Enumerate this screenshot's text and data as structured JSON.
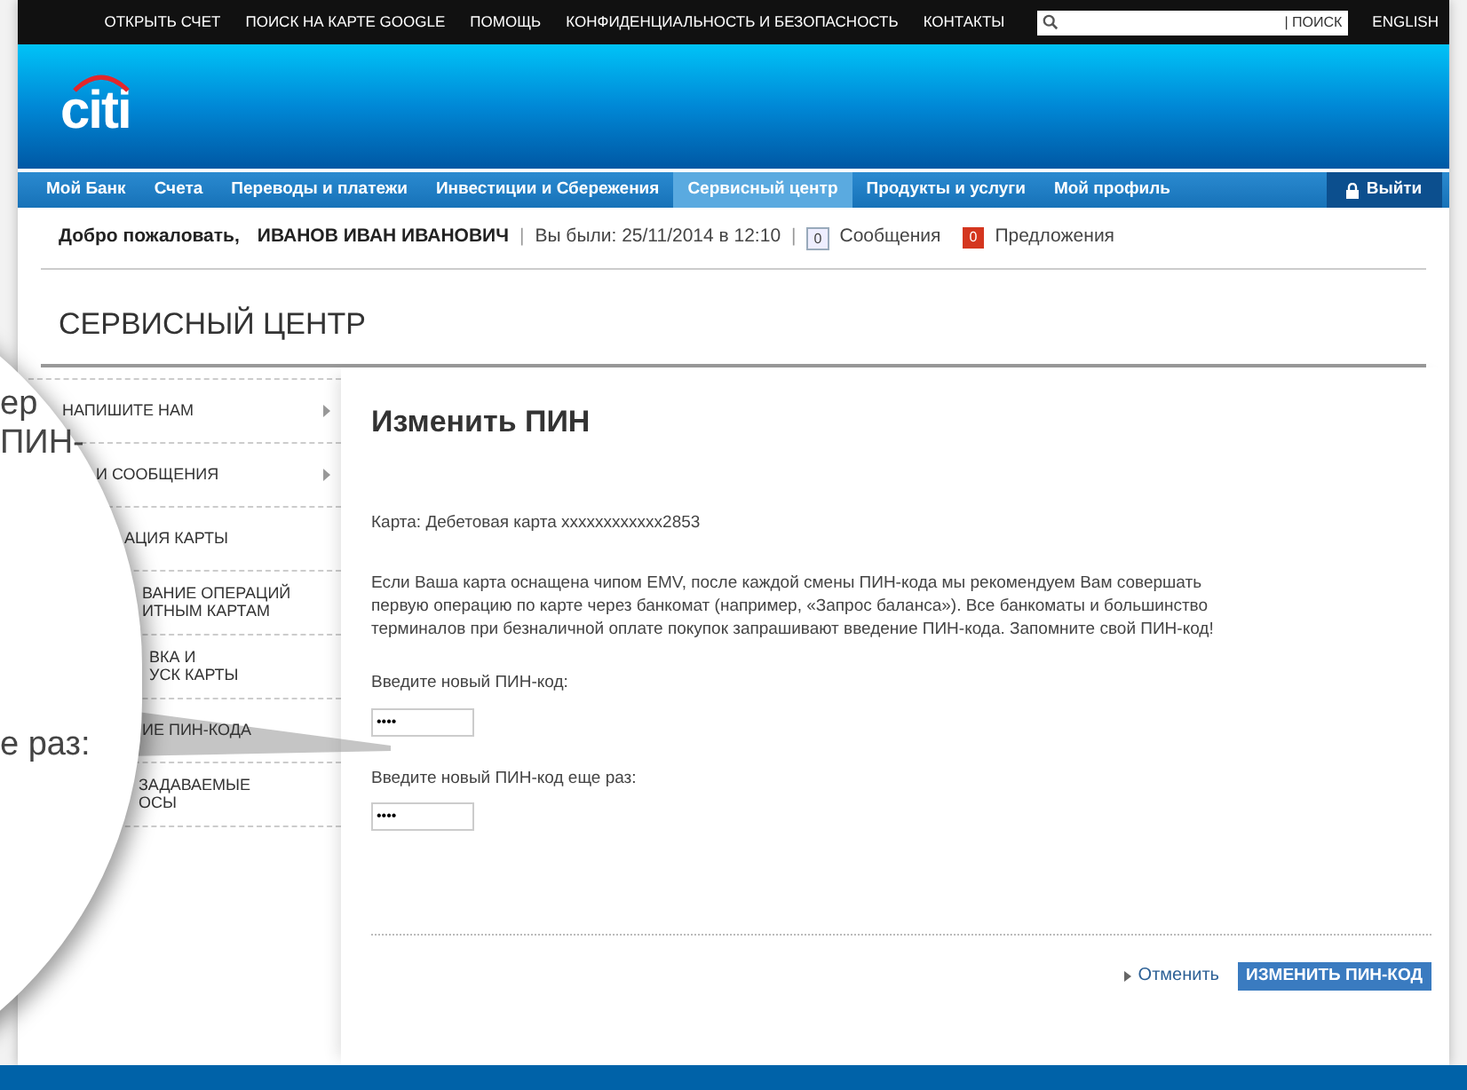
{
  "top_bar": {
    "links": [
      "ОТКРЫТЬ СЧЕТ",
      "ПОИСК НА КАРТЕ GOOGLE",
      "ПОМОЩЬ",
      "КОНФИДЕНЦИАЛЬНОСТЬ И БЕЗОПАСНОСТЬ",
      "КОНТАКТЫ"
    ],
    "search_button": "| ПОИСК",
    "language": "ENGLISH"
  },
  "header": {
    "logo": "citi"
  },
  "nav": {
    "items": [
      {
        "label": "Мой Банк",
        "selected": false
      },
      {
        "label": "Счета",
        "selected": false
      },
      {
        "label": "Переводы и платежи",
        "selected": false
      },
      {
        "label": "Инвестиции и Сбережения",
        "selected": false
      },
      {
        "label": "Сервисный центр",
        "selected": true
      },
      {
        "label": "Продукты и услуги",
        "selected": false
      },
      {
        "label": "Мой профиль",
        "selected": false
      }
    ],
    "logout": "Выйти"
  },
  "welcome": {
    "greeting": "Добро пожаловать,",
    "name": "ИВАНОВ ИВАН ИВАНОВИЧ",
    "separators": [
      "|",
      "|"
    ],
    "last_visit": "Вы были: 25/11/2014 в 12:10",
    "messages_count": "0",
    "messages": "Сообщения",
    "offers_count": "0",
    "offers": "Предложения"
  },
  "page_title": "СЕРВИСНЫЙ ЦЕНТР",
  "sidebar": {
    "items": [
      {
        "lines": [
          "НАПИШИТЕ НАМ"
        ],
        "has_arrow": true
      },
      {
        "lines": [
          "И СООБЩЕНИЯ"
        ],
        "has_arrow": true
      },
      {
        "lines": [
          "АЦИЯ КАРТЫ"
        ],
        "has_arrow": false
      },
      {
        "lines": [
          "ВАНИЕ ОПЕРАЦИЙ",
          "ИТНЫМ КАРТАМ"
        ],
        "has_arrow": false
      },
      {
        "lines": [
          "ВКА И",
          "УСК КАРТЫ"
        ],
        "has_arrow": false
      },
      {
        "lines": [
          "ИЕ ПИН-КОДА"
        ],
        "has_arrow": false
      },
      {
        "lines": [
          "ЗАДАВАЕМЫЕ",
          "ОСЫ"
        ],
        "has_arrow": false
      }
    ]
  },
  "magnifier": {
    "texts": [
      "ер",
      "ПИН-",
      "е раз:"
    ]
  },
  "content": {
    "heading": "Изменить ПИН",
    "card": "Карта: Дебетовая карта xxxxxxxxxxxx2853",
    "notice": "Если Ваша карта оснащена чипом EMV, после каждой смены ПИН-кода мы рекомендуем Вам совершать первую операцию по карте через банкомат (например, «Запрос баланса»). Все банкоматы и большинство терминалов при безналичной оплате покупок запрашивают введение ПИН-кода. Запомните свой ПИН-код!",
    "fields": [
      {
        "label": "Введите новый ПИН-код:",
        "value": "••••"
      },
      {
        "label": "Введите новый ПИН-код еще раз:",
        "value": "••••"
      }
    ],
    "cancel": "Отменить",
    "submit": "ИЗМЕНИТЬ ПИН-КОД"
  }
}
